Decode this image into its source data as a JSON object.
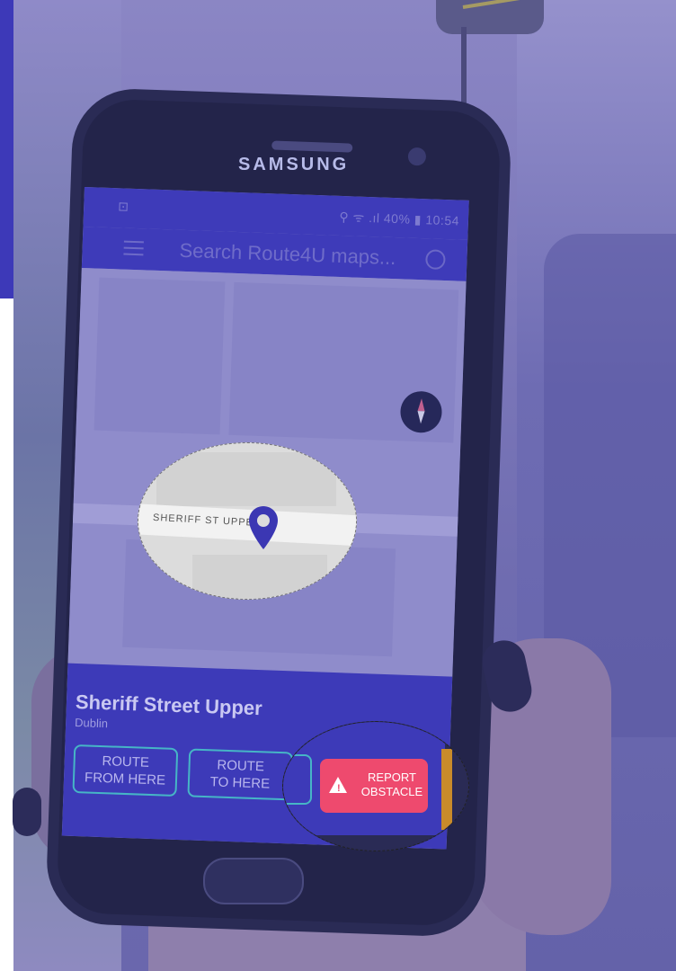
{
  "phone": {
    "brand": "SAMSUNG"
  },
  "status_bar": {
    "right_text": "⚲ ᯤ .ıl 40% ▮ 10:54",
    "left_icon": "notification-icon"
  },
  "app_bar": {
    "search_placeholder": "Search Route4U maps...",
    "menu_icon": "menu-icon",
    "search_icon": "search-icon"
  },
  "map": {
    "street_label": "SHERIFF ST UPPER",
    "compass_icon": "compass-icon",
    "locate_icon": "my-location-icon",
    "pin_icon": "location-pin-icon"
  },
  "place": {
    "title": "Sheriff Street Upper",
    "subtitle": "Dublin"
  },
  "actions": {
    "route_from_line1": "ROUTE",
    "route_from_line2": "FROM HERE",
    "route_to_line1": "ROUTE",
    "route_to_line2": "TO HERE",
    "report_line1": "REPORT",
    "report_line2": "OBSTACLE",
    "report_icon": "warning-icon"
  },
  "colors": {
    "overlay": "#3d39b8",
    "report": "#ee4a6e",
    "outline": "#46b5c6"
  }
}
